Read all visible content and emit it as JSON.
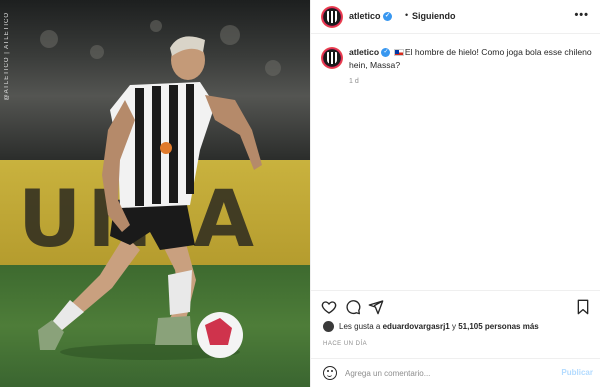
{
  "photo": {
    "watermark": "@ATLETICO | ATLETICO",
    "banner_text": "UNIA"
  },
  "header": {
    "username": "atletico",
    "separator": "•",
    "follow_status": "Siguiendo",
    "more_label": "•••"
  },
  "post": {
    "username": "atletico",
    "caption": "El hombre de hielo! Como joga bola esse chileno hein, Massa?",
    "time_ago": "1 d"
  },
  "actions": {
    "like_icon": "heart-icon",
    "comment_icon": "comment-icon",
    "share_icon": "share-icon",
    "save_icon": "bookmark-icon"
  },
  "likes": {
    "prefix": "Les gusta a",
    "user": "eduardovargasrj1",
    "middle": "y",
    "count": "51,105 personas más"
  },
  "date_label": "HACE UN DÍA",
  "comment": {
    "placeholder": "Agrega un comentario...",
    "publish_label": "Publicar"
  },
  "colors": {
    "verified": "#3897f0",
    "publish": "#b3dbff",
    "banner": "#c9b23e",
    "pitch": "#4e7d39"
  }
}
